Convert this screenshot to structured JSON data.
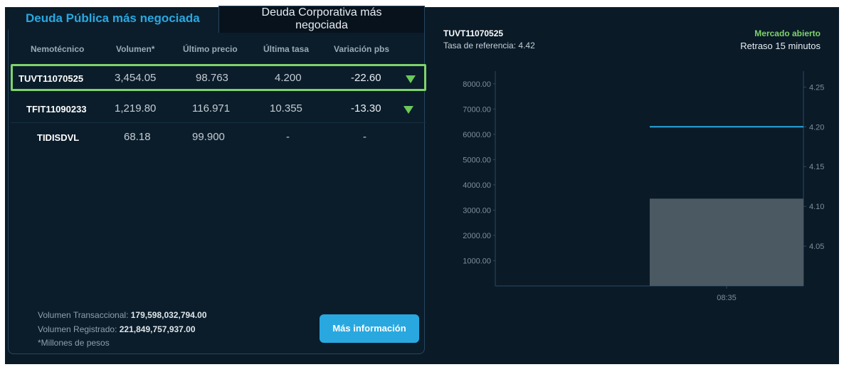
{
  "tabs": {
    "publica": "Deuda Pública más negociada",
    "corporativa_line1": "Deuda Corporativa más",
    "corporativa_line2": "negociada"
  },
  "table": {
    "headers": [
      "Nemotécnico",
      "Volumen*",
      "Último precio",
      "Última tasa",
      "Variación pbs"
    ],
    "rows": [
      {
        "nemotecnico": "TUVT11070525",
        "volumen": "3,454.05",
        "precio": "98.763",
        "tasa": "4.200",
        "variacion": "-22.60",
        "trend": "down"
      },
      {
        "nemotecnico": "TFIT11090233",
        "volumen": "1,219.80",
        "precio": "116.971",
        "tasa": "10.355",
        "variacion": "-13.30",
        "trend": "down"
      },
      {
        "nemotecnico": "TIDISDVL",
        "volumen": "68.18",
        "precio": "99.900",
        "tasa": "-",
        "variacion": "-",
        "trend": "none"
      }
    ]
  },
  "footer": {
    "vol_trans_label": "Volumen Transaccional:",
    "vol_trans_value": "179,598,032,794.00",
    "vol_reg_label": "Volumen Registrado:",
    "vol_reg_value": "221,849,757,937.00",
    "note": "*Millones de pesos",
    "button": "Más información"
  },
  "chart_header": {
    "title": "TUVT11070525",
    "subtitle": "Tasa de referencia: 4.42",
    "status": "Mercado abierto",
    "delay": "Retraso 15 minutos"
  },
  "colors": {
    "accent": "#29a8e0",
    "positive": "#7fd36a",
    "background": "#0a1a27",
    "bar": "#4b5963"
  },
  "chart_data": {
    "type": "bar",
    "categories": [
      "08:35"
    ],
    "series": [
      {
        "values": [
          3454.05
        ],
        "axis": "left"
      },
      {
        "values": [
          4.2
        ],
        "axis": "right",
        "type": "line"
      }
    ],
    "yleft_ticks": [
      "8000.00",
      "7000.00",
      "6000.00",
      "5000.00",
      "4000.00",
      "3000.00",
      "2000.00",
      "1000.00"
    ],
    "yleft_lim": [
      0,
      8500
    ],
    "yright_ticks": [
      "4.25",
      "4.20",
      "4.15",
      "4.10",
      "4.05"
    ],
    "yright_lim": [
      4.0,
      4.27
    ],
    "x_tick": "08:35"
  }
}
